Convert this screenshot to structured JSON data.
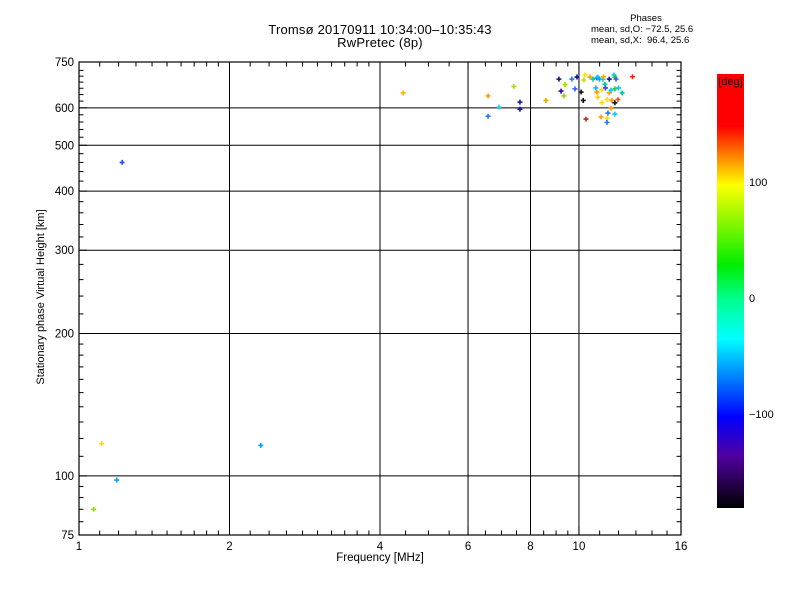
{
  "chart_data": {
    "type": "scatter",
    "title": "Tromsø 20170911 10:34:00–10:35:43",
    "subtitle": "RwPretec (8p)",
    "annotation": {
      "header": "Phases",
      "lines": [
        "mean, sd,O: −72.5, 25.6",
        "mean, sd,X:  96.4, 25.6"
      ]
    },
    "xlabel": "Frequency [MHz]",
    "ylabel": "Stationary phase Virtual Height [km]",
    "x_scale": "log",
    "y_scale": "log",
    "xlim": [
      1,
      16
    ],
    "ylim": [
      75,
      750
    ],
    "x_ticks": [
      1,
      2,
      4,
      6,
      8,
      10,
      16
    ],
    "y_ticks": [
      75,
      100,
      200,
      300,
      400,
      500,
      600,
      750
    ],
    "x_minor_ticks": [
      1.1,
      1.2,
      1.3,
      1.4,
      1.5,
      1.6,
      1.7,
      1.8,
      1.9,
      2.2,
      2.4,
      2.6,
      2.8,
      3,
      3.2,
      3.4,
      3.6,
      3.8,
      4.5,
      5,
      5.5,
      6.5,
      7,
      7.5,
      8.5,
      9,
      9.5,
      11,
      12,
      13,
      14,
      15
    ],
    "y_minor_ticks": [
      80,
      85,
      90,
      95,
      110,
      120,
      130,
      140,
      150,
      160,
      170,
      180,
      190,
      220,
      240,
      260,
      280,
      320,
      340,
      360,
      380,
      420,
      440,
      460,
      480,
      520,
      540,
      560,
      580,
      620,
      640,
      660,
      680,
      700,
      720
    ],
    "x_gridlines": [
      2,
      4,
      6,
      8,
      10
    ],
    "y_gridlines": [
      100,
      200,
      300,
      400,
      500,
      600
    ],
    "grid": "solid black lines at labeled ticks",
    "legend_position": "none",
    "marker": "plus",
    "points_format": [
      "freq_mhz",
      "virtual_height_km",
      "phase_color"
    ],
    "points": [
      [
        1.07,
        85,
        "#8FE000"
      ],
      [
        1.11,
        117,
        "#FFD700"
      ],
      [
        1.19,
        98,
        "#00A0FF"
      ],
      [
        1.22,
        460,
        "#2050FF"
      ],
      [
        2.31,
        116,
        "#00A0FF"
      ],
      [
        4.45,
        645,
        "#FFB000"
      ],
      [
        6.58,
        636,
        "#FF9900"
      ],
      [
        6.58,
        576,
        "#1E78FF"
      ],
      [
        6.92,
        602,
        "#00DDDD"
      ],
      [
        7.41,
        666,
        "#A5E000"
      ],
      [
        7.62,
        617,
        "#1A1AA0"
      ],
      [
        7.62,
        596,
        "#1A1AA0"
      ],
      [
        8.59,
        622,
        "#FF9900"
      ],
      [
        9.12,
        690,
        "#101080"
      ],
      [
        9.21,
        651,
        "#3A00A0"
      ],
      [
        9.38,
        672,
        "#9FE000"
      ],
      [
        9.33,
        636,
        "#8FD500"
      ],
      [
        9.68,
        690,
        "#1E78FF"
      ],
      [
        9.82,
        658,
        "#2860FF"
      ],
      [
        9.91,
        697,
        "#101080"
      ],
      [
        10.1,
        648,
        "#151515"
      ],
      [
        10.2,
        622,
        "#101010"
      ],
      [
        10.28,
        704,
        "#FFE000"
      ],
      [
        10.23,
        687,
        "#BFE800"
      ],
      [
        10.33,
        568,
        "#B03010"
      ],
      [
        10.52,
        697,
        "#FFA000"
      ],
      [
        10.67,
        690,
        "#00C896"
      ],
      [
        10.81,
        661,
        "#00BBFF"
      ],
      [
        10.86,
        694,
        "#1E78FF"
      ],
      [
        10.86,
        648,
        "#FF9900"
      ],
      [
        10.91,
        697,
        "#00CCFF"
      ],
      [
        10.91,
        632,
        "#FFD000"
      ],
      [
        11.0,
        690,
        "#00A0FF"
      ],
      [
        11.07,
        574,
        "#FFA500"
      ],
      [
        11.1,
        655,
        "#FFD700"
      ],
      [
        11.12,
        615,
        "#FFDD00"
      ],
      [
        11.17,
        690,
        "#00CCFF"
      ],
      [
        11.2,
        698,
        "#FFA500"
      ],
      [
        11.27,
        673,
        "#00CC88"
      ],
      [
        11.3,
        661,
        "#4040E0"
      ],
      [
        11.38,
        625,
        "#FFE000"
      ],
      [
        11.38,
        571,
        "#FFD700"
      ],
      [
        11.38,
        559,
        "#1E78FF"
      ],
      [
        11.43,
        585,
        "#1E78FF"
      ],
      [
        11.5,
        690,
        "#101080"
      ],
      [
        11.5,
        645,
        "#FFA500"
      ],
      [
        11.59,
        654,
        "#00CCFF"
      ],
      [
        11.59,
        599,
        "#FFA000"
      ],
      [
        11.64,
        622,
        "#FF9900"
      ],
      [
        11.75,
        704,
        "#00CCFF"
      ],
      [
        11.8,
        697,
        "#22CC22"
      ],
      [
        11.8,
        658,
        "#22CC22"
      ],
      [
        11.8,
        615,
        "#151515"
      ],
      [
        11.8,
        582,
        "#00CCFF"
      ],
      [
        11.86,
        690,
        "#2860FF"
      ],
      [
        11.97,
        625,
        "#FF5020"
      ],
      [
        12.0,
        661,
        "#00CCFF"
      ],
      [
        12.2,
        645,
        "#00C896"
      ],
      [
        12.8,
        698,
        "#FF2000"
      ]
    ],
    "colorbar": {
      "label": "[deg]",
      "unit": "deg",
      "ticks": [
        100,
        0,
        -100
      ],
      "value_min": -180,
      "value_max": 195,
      "gradient_stops": [
        {
          "pct": 0,
          "color": "#FF0000"
        },
        {
          "pct": 12,
          "color": "#FF0000"
        },
        {
          "pct": 25.5,
          "color": "#FFFF00"
        },
        {
          "pct": 44,
          "color": "#00EE00"
        },
        {
          "pct": 52,
          "color": "#00FF90"
        },
        {
          "pct": 61,
          "color": "#00FFFF"
        },
        {
          "pct": 79,
          "color": "#0000FF"
        },
        {
          "pct": 88,
          "color": "#5000A0"
        },
        {
          "pct": 100,
          "color": "#000000"
        }
      ]
    },
    "axis_color": "#000000",
    "background_color": "#FFFFFF"
  }
}
